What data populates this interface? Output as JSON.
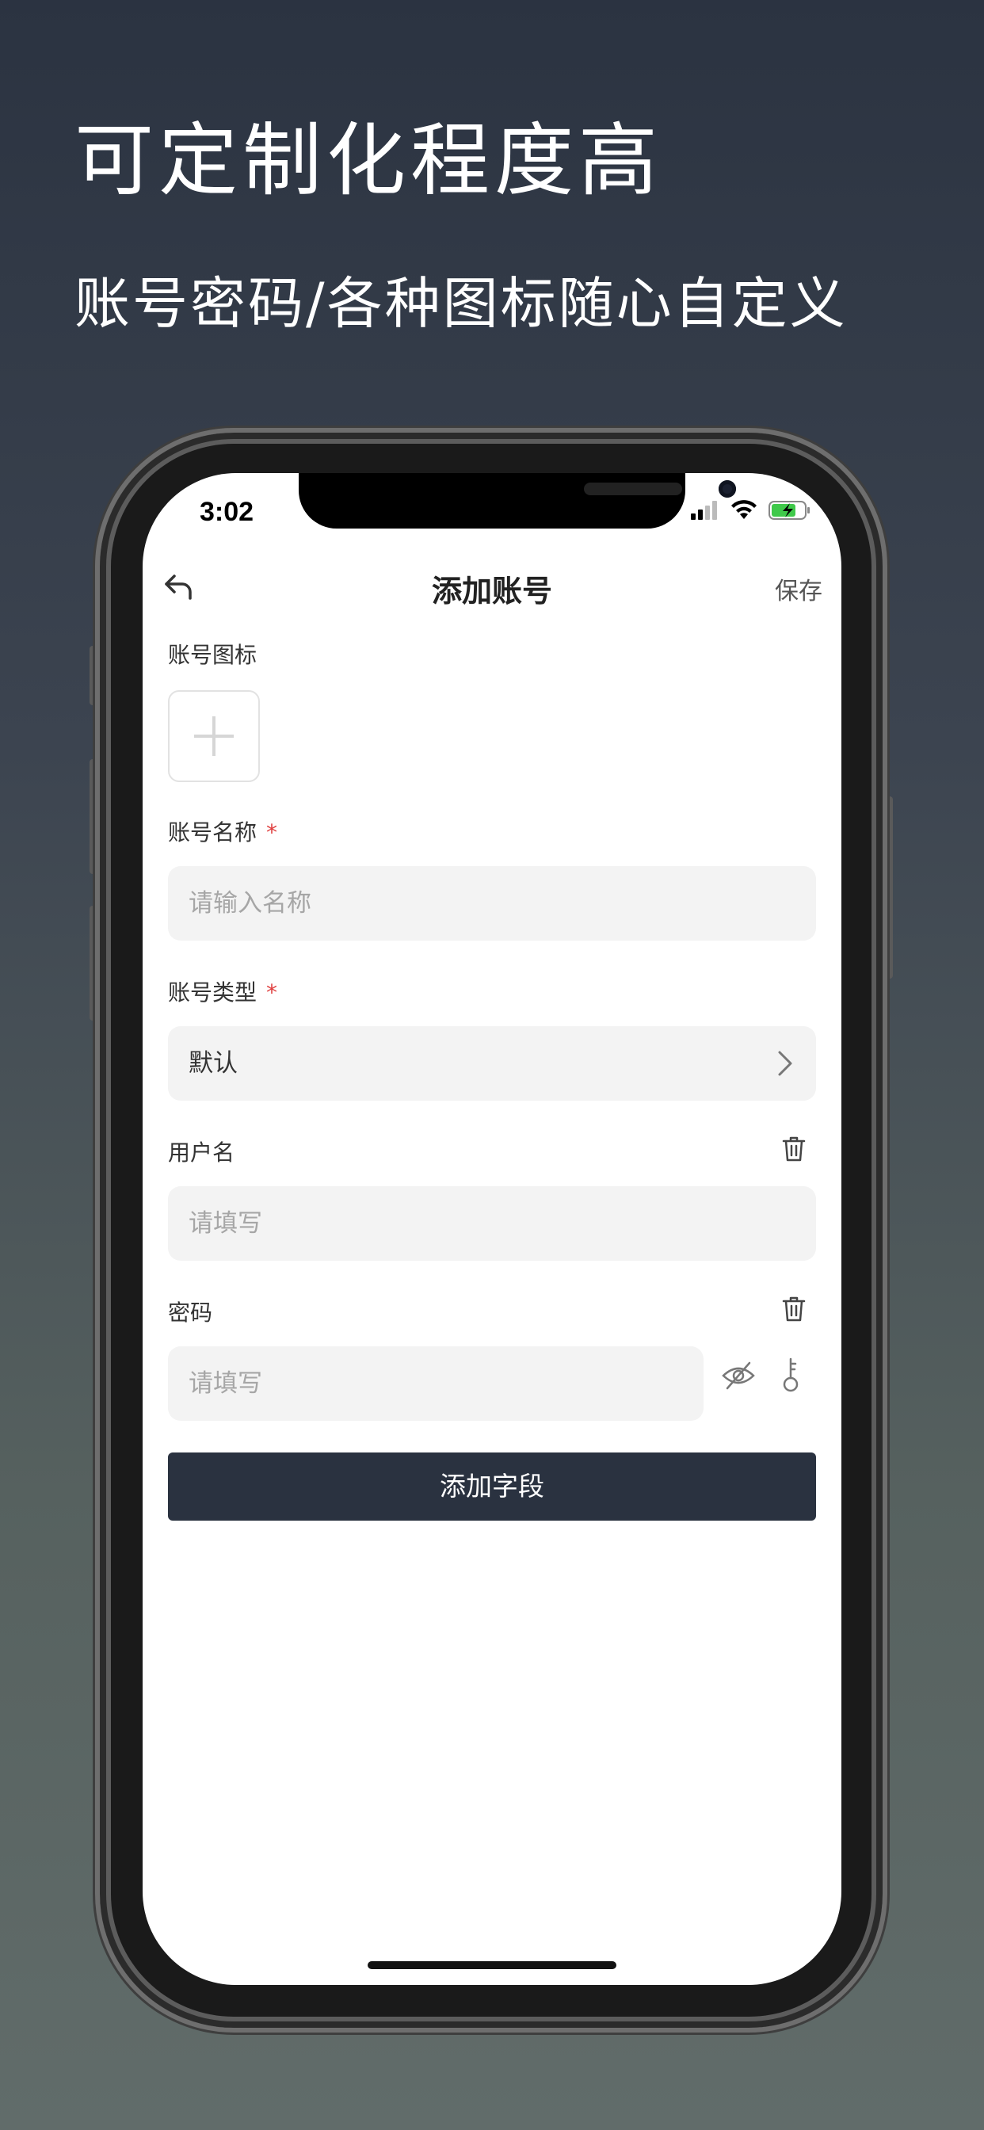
{
  "promo": {
    "title": "可定制化程度高",
    "subtitle": "账号密码/各种图标随心自定义"
  },
  "status_bar": {
    "time": "3:02"
  },
  "nav": {
    "title": "添加账号",
    "save_label": "保存"
  },
  "form": {
    "icon_label": "账号图标",
    "name_label": "账号名称",
    "name_required": "*",
    "name_placeholder": "请输入名称",
    "type_label": "账号类型",
    "type_required": "*",
    "type_value": "默认",
    "username_label": "用户名",
    "username_placeholder": "请填写",
    "password_label": "密码",
    "password_placeholder": "请填写",
    "add_field_label": "添加字段"
  },
  "colors": {
    "background_top": "#2b3341",
    "background_bottom": "#616c6a",
    "button": "#2a3240",
    "required": "#e04040",
    "battery": "#3fc94a"
  },
  "icons": {
    "back": "back-arrow-icon",
    "chevron": "chevron-right-icon",
    "trash": "trash-icon",
    "eye": "eye-off-icon",
    "key": "key-icon",
    "add": "plus-icon"
  }
}
